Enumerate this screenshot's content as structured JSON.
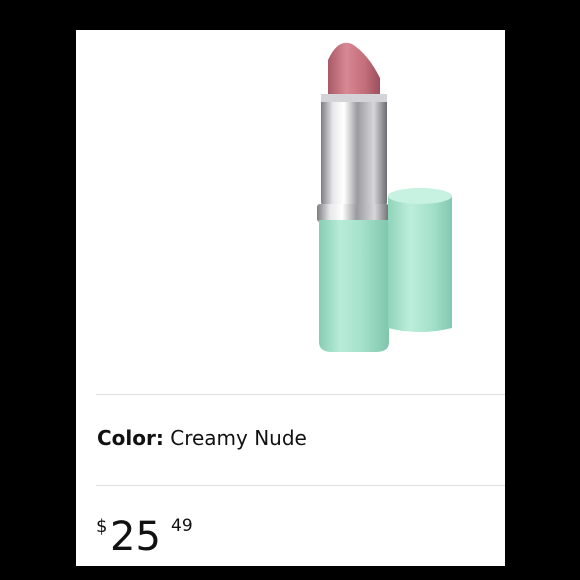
{
  "product": {
    "image_alt": "lipstick-product-image",
    "color_label": "Color:",
    "color_value": "Creamy Nude"
  },
  "price": {
    "symbol": "$",
    "whole": "25",
    "fraction": "49"
  },
  "colors": {
    "background": "#000000",
    "card": "#ffffff",
    "divider": "#dddddd",
    "lipstick_tube": "#a8e4cc",
    "lipstick_bullet": "#c9737e",
    "metal": "#b8b8bc"
  }
}
